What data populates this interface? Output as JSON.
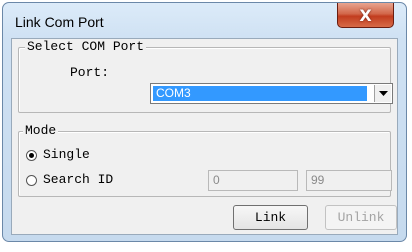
{
  "window": {
    "title": "Link Com Port",
    "close_glyph": "X"
  },
  "select_group": {
    "legend": "Select COM Port",
    "port_label": "Port:",
    "port_value": "COM3"
  },
  "mode_group": {
    "legend": "Mode",
    "options": [
      {
        "label": "Single",
        "selected": true
      },
      {
        "label": "Search ID",
        "selected": false
      }
    ],
    "search_from": "0",
    "search_to": "99"
  },
  "buttons": {
    "link": "Link",
    "unlink": "Unlink"
  },
  "colors": {
    "selection": "#3399ff",
    "close_button": "#c23d1f"
  }
}
